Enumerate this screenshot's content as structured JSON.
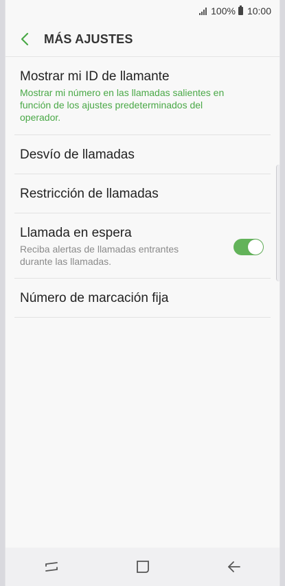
{
  "status_bar": {
    "battery_percent": "100%",
    "time": "10:00"
  },
  "header": {
    "title": "MÁS AJUSTES"
  },
  "settings": [
    {
      "title": "Mostrar mi ID de llamante",
      "subtitle": "Mostrar mi número en las llamadas salientes en función de los ajustes predeterminados del operador."
    },
    {
      "title": "Desvío de llamadas"
    },
    {
      "title": "Restricción de llamadas"
    },
    {
      "title": "Llamada en espera",
      "subtitle": "Reciba alertas de llamadas entrantes durante las llamadas.",
      "toggle_on": true
    },
    {
      "title": "Número de marcación fija"
    }
  ],
  "colors": {
    "accent": "#49a846",
    "toggle": "#63b35a",
    "background": "#f8f8f8"
  },
  "icons": {
    "back": "chevron-left-icon",
    "recent": "recent-apps-icon",
    "home": "home-icon",
    "nav_back": "arrow-left-icon"
  }
}
